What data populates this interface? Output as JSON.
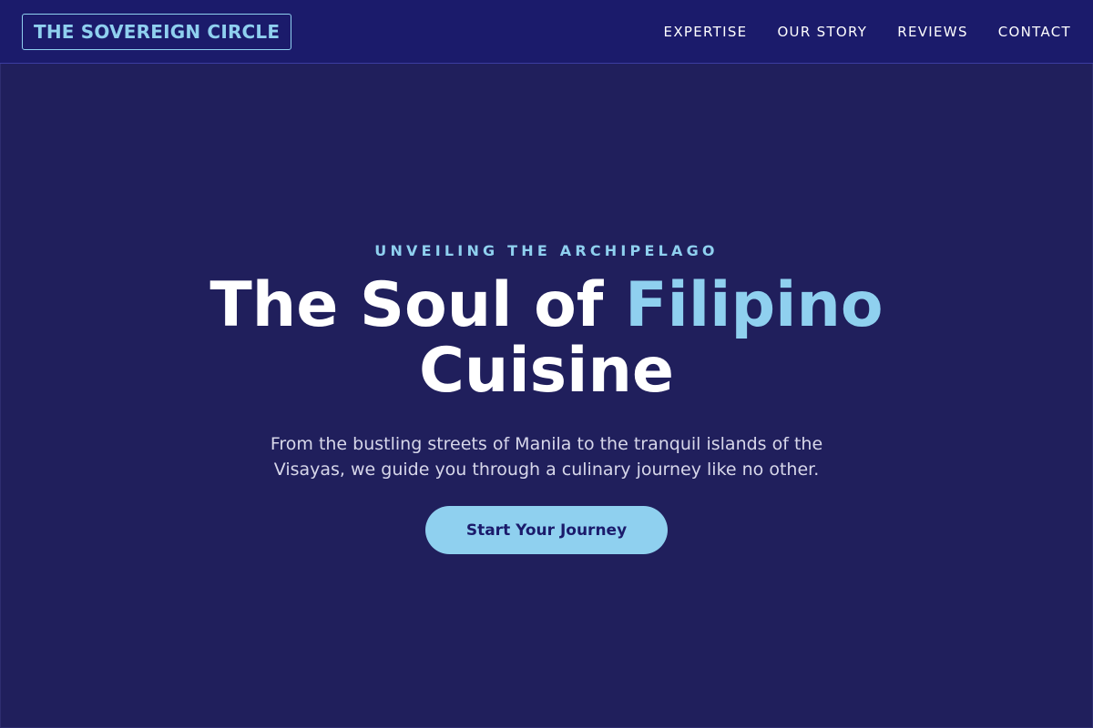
{
  "brand": {
    "logo_text": "THE SOVEREIGN CIRCLE"
  },
  "nav": {
    "items": [
      {
        "label": "EXPERTISE"
      },
      {
        "label": "OUR STORY"
      },
      {
        "label": "REVIEWS"
      },
      {
        "label": "CONTACT"
      }
    ]
  },
  "hero": {
    "kicker": "UNVEILING THE ARCHIPELAGO",
    "title_part1": "The Soul of ",
    "title_accent": "Filipino",
    "title_part2": "Cuisine",
    "subtitle": "From the bustling streets of Manila to the tranquil islands of the Visayas, we guide you through a culinary journey like no other.",
    "cta_label": "Start Your Journey"
  },
  "colors": {
    "nav_background": "#1b1b6b",
    "accent": "#8fd0ef",
    "hero_overlay": "#181858"
  }
}
